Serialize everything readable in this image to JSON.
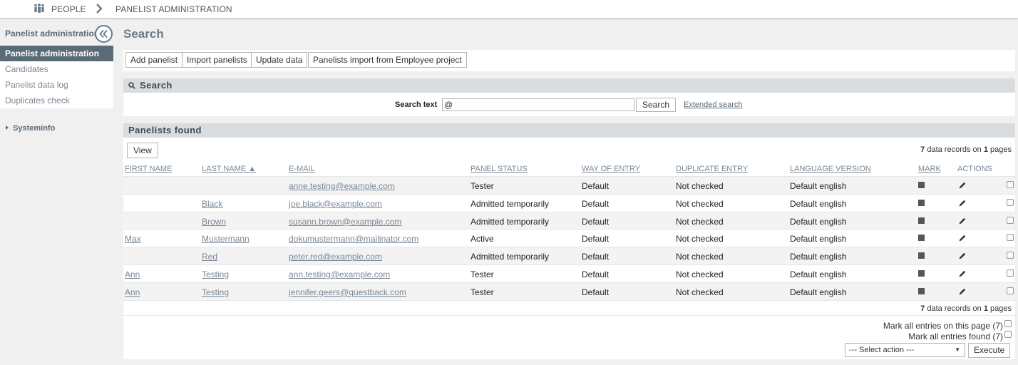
{
  "topbar": {
    "crumb_people": "PEOPLE",
    "crumb_admin": "PANELIST ADMINISTRATION",
    "people_icon": "people-icon",
    "separator_icon": "chevron-right-icon"
  },
  "sidebar": {
    "title": "Panelist administration",
    "collapse_icon": "double-chevron-left-icon",
    "items": [
      {
        "label": "Panelist administration",
        "active": true
      },
      {
        "label": "Candidates",
        "active": false
      },
      {
        "label": "Panelist data log",
        "active": false
      },
      {
        "label": "Duplicates check",
        "active": false
      }
    ],
    "systeminfo": "Systeminfo"
  },
  "main": {
    "title": "Search",
    "toolbar": {
      "add": "Add panelist",
      "import": "Import panelists",
      "update": "Update data",
      "employee_import": "Panelists import from Employee project"
    },
    "search": {
      "heading": "Search",
      "label": "Search text",
      "value": "@",
      "button": "Search",
      "extended": "Extended search"
    },
    "results": {
      "heading": "Panelists found",
      "view_button": "View",
      "count": {
        "records": "7",
        "middle": " data records on ",
        "pages": "1",
        "suffix": " pages"
      },
      "columns": {
        "first_name": "FIRST NAME",
        "last_name": "LAST NAME ▲",
        "email": "E-MAIL",
        "panel_status": "PANEL STATUS",
        "way_of_entry": "WAY OF ENTRY",
        "duplicate_entry": "DUPLICATE ENTRY",
        "language_version": "LANGUAGE VERSION",
        "mark": "MARK",
        "actions": "ACTIONS"
      },
      "rows": [
        {
          "first": "",
          "last": "",
          "email": "anne.testing@example.com",
          "status": "Tester",
          "entry": "Default",
          "dup": "Not checked",
          "lang": "Default english"
        },
        {
          "first": "",
          "last": "Black",
          "email": "joe.black@example.com",
          "status": "Admitted temporarily",
          "entry": "Default",
          "dup": "Not checked",
          "lang": "Default english"
        },
        {
          "first": "",
          "last": "Brown",
          "email": "susann.brown@example.com",
          "status": "Admitted temporarily",
          "entry": "Default",
          "dup": "Not checked",
          "lang": "Default english"
        },
        {
          "first": "Max",
          "last": "Mustermann",
          "email": "dokumustermann@mailinator.com",
          "status": "Active",
          "entry": "Default",
          "dup": "Not checked",
          "lang": "Default english"
        },
        {
          "first": "",
          "last": "Red",
          "email": "peter.red@example.com",
          "status": "Admitted temporarily",
          "entry": "Default",
          "dup": "Not checked",
          "lang": "Default english"
        },
        {
          "first": "Ann",
          "last": "Testing",
          "email": "ann.testing@example.com",
          "status": "Tester",
          "entry": "Default",
          "dup": "Not checked",
          "lang": "Default english"
        },
        {
          "first": "Ann",
          "last": "Testing",
          "email": "jennifer.geers@questback.com",
          "status": "Tester",
          "entry": "Default",
          "dup": "Not checked",
          "lang": "Default english"
        }
      ],
      "mark_page": "Mark all entries on this page (7)",
      "mark_found": "Mark all entries found (7)",
      "select_action": "--- Select action ---",
      "execute": "Execute"
    }
  }
}
